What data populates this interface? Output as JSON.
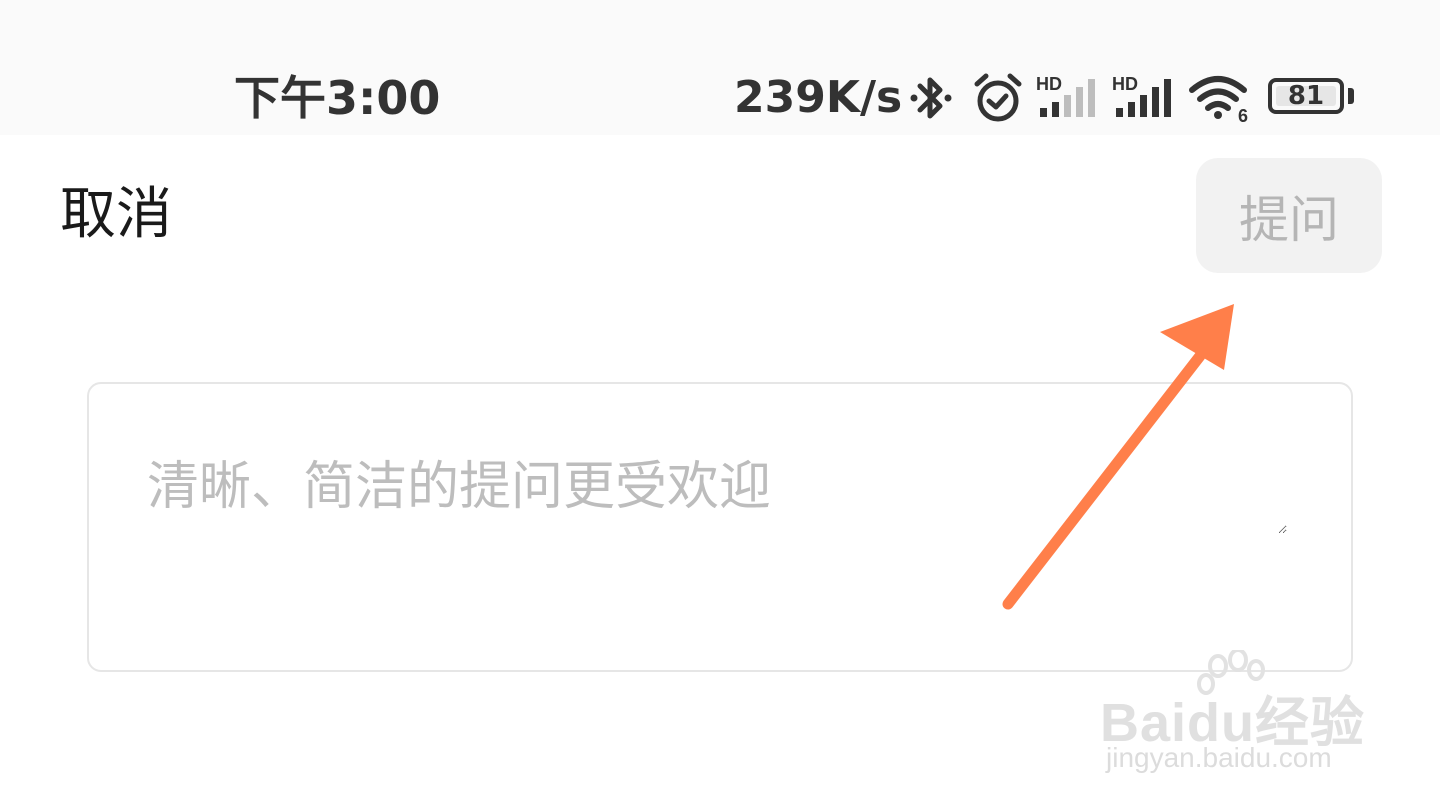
{
  "status_bar": {
    "time": "下午3:00",
    "net_speed": "239K/s",
    "battery": "81",
    "icons": [
      "bluetooth-icon",
      "alarm-icon",
      "hd-signal-icon-1",
      "hd-signal-icon-2",
      "wifi6-icon",
      "battery-icon"
    ]
  },
  "header": {
    "cancel_label": "取消",
    "ask_label": "提问"
  },
  "question": {
    "value": "",
    "placeholder": "清晰、简洁的提问更受欢迎"
  },
  "watermark": {
    "brand": "Baidu经验",
    "url": "jingyan.baidu.com"
  },
  "colors": {
    "annotation_arrow": "#ff7f4a",
    "button_bg": "#f2f2f2",
    "button_text_disabled": "#b5b5b5",
    "placeholder": "#bdbdbd"
  }
}
